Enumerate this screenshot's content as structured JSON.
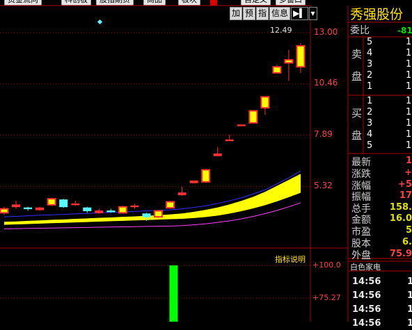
{
  "top_tabs": [
    {
      "label": "资金流向",
      "red": false
    },
    {
      "label": "科创板",
      "red": false
    },
    {
      "label": "股指期货",
      "red": false
    },
    {
      "label": "商品",
      "red": false
    },
    {
      "label": "板块",
      "red": false
    },
    {
      "label": "",
      "red": true
    },
    {
      "label": "自定义",
      "red": false
    },
    {
      "label": "多窗口",
      "red": false
    }
  ],
  "toolbar": {
    "add": "加",
    "predict": "预",
    "indicator": "指",
    "info": "信息",
    "next": "▶▍",
    "dropdown": "▾"
  },
  "price_axis": [
    "13.00",
    "10.46",
    "7.89",
    "5.32"
  ],
  "max_price_label": "12.49",
  "indicator": {
    "help_label": "指标说明",
    "axis": [
      "+100.0",
      "+75.27"
    ]
  },
  "colors": {
    "up": "#ff3030",
    "down": "#54ffff",
    "fill": "#ffff00",
    "ma_blue": "#3030ff",
    "ma_pink": "#ff40ff",
    "bar": "#00ff00",
    "grid": "#b00000"
  },
  "stock_name": "秀强股份",
  "order_book": {
    "weibi_label": "委比",
    "weibi_value": "-81",
    "sell_label": [
      "卖",
      "盘"
    ],
    "buy_label": [
      "买",
      "盘"
    ],
    "sell_levels": [
      {
        "level": "5",
        "value": "1"
      },
      {
        "level": "4",
        "value": "1"
      },
      {
        "level": "3",
        "value": "1"
      },
      {
        "level": "2",
        "value": "1"
      },
      {
        "level": "1",
        "value": "1"
      }
    ],
    "buy_levels": [
      {
        "level": "1",
        "value": "1"
      },
      {
        "level": "2",
        "value": "1"
      },
      {
        "level": "3",
        "value": "1"
      },
      {
        "level": "4",
        "value": "1"
      },
      {
        "level": "5",
        "value": "1"
      }
    ]
  },
  "stats": [
    {
      "label": "最新",
      "value": "1",
      "color": "r"
    },
    {
      "label": "涨跌",
      "value": "+",
      "color": "r"
    },
    {
      "label": "涨幅",
      "value": "+5",
      "color": "r"
    },
    {
      "label": "振幅",
      "value": "17",
      "color": "r"
    },
    {
      "label": "总手",
      "value": "158.",
      "color": "c"
    },
    {
      "label": "金额",
      "value": "16.0",
      "color": "c"
    },
    {
      "label": "市盈",
      "value": "5",
      "color": "c"
    },
    {
      "label": "股本",
      "value": "6.",
      "color": "c"
    },
    {
      "label": "外盘",
      "value": "75.9",
      "color": "r"
    }
  ],
  "tape_header": "白色家电",
  "tape": [
    {
      "time": "14:56",
      "value": "1"
    },
    {
      "time": "14:56",
      "value": "1"
    },
    {
      "time": "14:56",
      "value": "1"
    },
    {
      "time": "14:56",
      "value": "1"
    }
  ],
  "chart_data": {
    "type": "candlestick",
    "y_axis_ticks": [
      13.0,
      10.46,
      7.89,
      5.32
    ],
    "ylim": [
      2.9,
      13.6
    ],
    "candles": [
      {
        "o": 4.0,
        "c": 4.2,
        "h": 4.3,
        "l": 3.9
      },
      {
        "o": 4.3,
        "c": 4.4,
        "h": 4.6,
        "l": 4.2
      },
      {
        "o": 4.25,
        "c": 4.2,
        "h": 4.3,
        "l": 4.1
      },
      {
        "o": 4.15,
        "c": 4.25,
        "h": 4.3,
        "l": 4.1
      },
      {
        "o": 4.4,
        "c": 4.7,
        "h": 4.75,
        "l": 4.35
      },
      {
        "o": 4.65,
        "c": 4.3,
        "h": 4.7,
        "l": 4.25
      },
      {
        "o": 4.4,
        "c": 4.45,
        "h": 4.6,
        "l": 4.35
      },
      {
        "o": 4.25,
        "c": 4.1,
        "h": 4.3,
        "l": 4.0
      },
      {
        "o": 4.0,
        "c": 4.1,
        "h": 4.2,
        "l": 3.95
      },
      {
        "o": 4.1,
        "c": 4.05,
        "h": 4.2,
        "l": 4.0
      },
      {
        "o": 4.0,
        "c": 4.3,
        "h": 4.35,
        "l": 3.95
      },
      {
        "o": 4.3,
        "c": 4.35,
        "h": 4.45,
        "l": 4.2
      },
      {
        "o": 3.95,
        "c": 3.8,
        "h": 4.0,
        "l": 3.6
      },
      {
        "o": 3.8,
        "c": 4.1,
        "h": 4.15,
        "l": 3.75
      },
      {
        "o": 4.25,
        "c": 4.55,
        "h": 4.6,
        "l": 4.2
      },
      {
        "o": 4.9,
        "c": 5.0,
        "h": 5.3,
        "l": 4.85
      },
      {
        "o": 5.5,
        "c": 5.6,
        "h": 5.6,
        "l": 5.5
      },
      {
        "o": 5.55,
        "c": 6.15,
        "h": 6.2,
        "l": 5.5
      },
      {
        "o": 6.85,
        "c": 6.95,
        "h": 7.3,
        "l": 6.85
      },
      {
        "o": 7.6,
        "c": 7.65,
        "h": 7.9,
        "l": 7.6
      },
      {
        "o": 8.35,
        "c": 8.4,
        "h": 8.4,
        "l": 8.35
      },
      {
        "o": 8.5,
        "c": 9.1,
        "h": 9.1,
        "l": 8.5
      },
      {
        "o": 9.25,
        "c": 9.8,
        "h": 9.8,
        "l": 8.9
      },
      {
        "o": 11.0,
        "c": 11.3,
        "h": 11.4,
        "l": 11.0
      },
      {
        "o": 11.5,
        "c": 11.65,
        "h": 12.15,
        "l": 10.6
      },
      {
        "o": 11.3,
        "c": 12.35,
        "h": 12.49,
        "l": 11.0
      }
    ],
    "ma_blue": [
      3.8,
      3.82,
      3.85,
      3.88,
      3.9,
      3.92,
      3.95,
      3.97,
      4.0,
      4.02,
      4.05,
      4.07,
      4.1,
      4.12,
      4.15,
      4.2,
      4.27,
      4.35,
      4.47,
      4.6,
      4.75,
      4.95,
      5.15,
      5.45,
      5.75,
      6.1
    ],
    "ma_yellow_top": [
      3.55,
      3.57,
      3.6,
      3.62,
      3.65,
      3.67,
      3.7,
      3.72,
      3.75,
      3.77,
      3.8,
      3.82,
      3.85,
      3.88,
      3.92,
      3.97,
      4.05,
      4.15,
      4.27,
      4.42,
      4.6,
      4.8,
      5.05,
      5.35,
      5.65,
      5.95
    ],
    "ma_yellow_bottom": [
      3.4,
      3.42,
      3.44,
      3.46,
      3.48,
      3.5,
      3.52,
      3.54,
      3.56,
      3.58,
      3.6,
      3.62,
      3.64,
      3.66,
      3.68,
      3.7,
      3.74,
      3.79,
      3.86,
      3.96,
      4.08,
      4.22,
      4.38,
      4.57,
      4.78,
      5.0
    ],
    "ma_pink": [
      3.2,
      3.21,
      3.22,
      3.23,
      3.24,
      3.25,
      3.26,
      3.27,
      3.28,
      3.29,
      3.3,
      3.31,
      3.32,
      3.33,
      3.34,
      3.36,
      3.4,
      3.45,
      3.52,
      3.6,
      3.7,
      3.82,
      3.96,
      4.12,
      4.3,
      4.5
    ],
    "indicator_bars": [
      {
        "index": 11,
        "value": 100.0
      }
    ],
    "indicator_ylim": [
      0,
      100.0
    ]
  }
}
